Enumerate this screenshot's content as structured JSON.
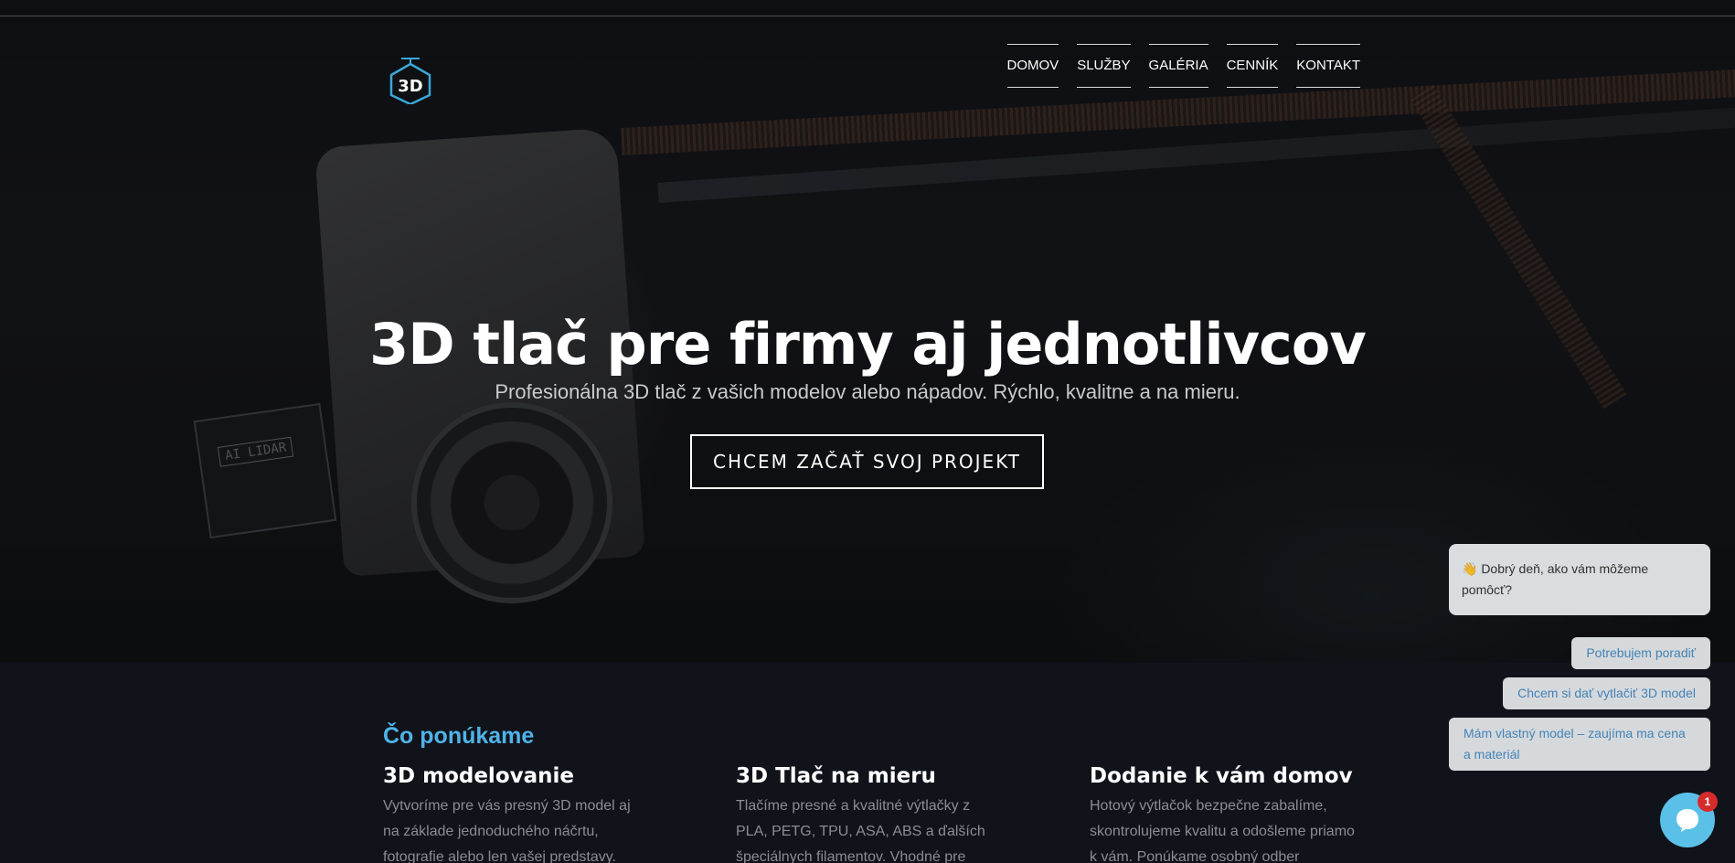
{
  "header": {
    "logo_text": "3D",
    "nav": [
      {
        "label": "DOMOV"
      },
      {
        "label": "SLUŽBY"
      },
      {
        "label": "GALÉRIA"
      },
      {
        "label": "CENNÍK"
      },
      {
        "label": "KONTAKT"
      }
    ]
  },
  "hero": {
    "title": "3D tlač pre firmy aj jednotlivcov",
    "subtitle": "Profesionálna 3D tlač z vašich modelov alebo nápadov. Rýchlo, kvalitne a na mieru.",
    "cta_label": "CHCEM ZAČAŤ SVOJ PROJEKT",
    "image_label": "AI LIDAR"
  },
  "services": {
    "heading": "Čo ponúkame",
    "items": [
      {
        "title": "3D modelovanie",
        "text": "Vytvoríme pre vás presný 3D model aj na základe jednoduchého náčrtu, fotografie alebo len vašej predstavy."
      },
      {
        "title": "3D Tlač na mieru",
        "text": "Tlačíme presné a kvalitné výtlačky z PLA, PETG, TPU, ASA, ABS a ďalších špeciálnych filamentov. Vhodné pre"
      },
      {
        "title": "Dodanie k vám domov",
        "text": "Hotový výtlačok bezpečne zabalíme, skontrolujeme kvalitu a odošleme priamo k vám. Ponúkame osobný odber"
      }
    ]
  },
  "chat": {
    "greeting": "👋 Dobrý deň, ako vám môžeme pomôcť?",
    "options": [
      "Potrebujem poradiť",
      "Chcem si dať vytlačiť 3D model",
      "Mám vlastný model – zaujíma ma cena a materiál"
    ],
    "badge": "1"
  },
  "colors": {
    "accent": "#4fb3e8",
    "chat_launcher": "#5bc0e8",
    "badge": "#d62b2b",
    "background": "#10131a"
  }
}
